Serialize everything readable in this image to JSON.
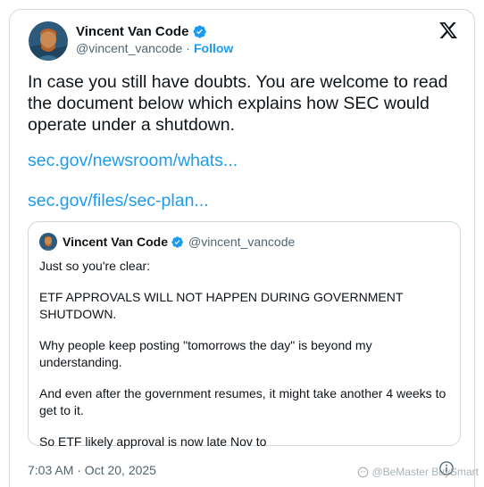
{
  "author": {
    "name": "Vincent Van Code",
    "handle": "@vincent_vancode",
    "follow_label": "Follow",
    "separator": "·"
  },
  "tweet": {
    "text": "In case you still have doubts.  You are welcome to read the document below which explains how SEC would operate under a shutdown.",
    "links": [
      "sec.gov/newsroom/whats...",
      "sec.gov/files/sec-plan..."
    ]
  },
  "quoted": {
    "name": "Vincent Van Code",
    "handle": "@vincent_vancode",
    "paragraphs": [
      "Just so you're clear:",
      "ETF APPROVALS WILL NOT HAPPEN DURING GOVERNMENT SHUTDOWN.",
      "Why people keep posting \"tomorrows the day\" is beyond my understanding.",
      "And even after the government resumes, it might take another 4 weeks to get to it.",
      "So ETF likely approval is now late Nov to"
    ]
  },
  "timestamp": "7:03 AM · Oct 20, 2025",
  "watermark": "@BeMaster BuySmart",
  "colors": {
    "accent": "#1d9bf0",
    "text": "#0f1419",
    "muted": "#536471",
    "border": "#cfd9de"
  },
  "icons": [
    "verified-badge-icon",
    "x-logo-icon",
    "info-icon"
  ]
}
